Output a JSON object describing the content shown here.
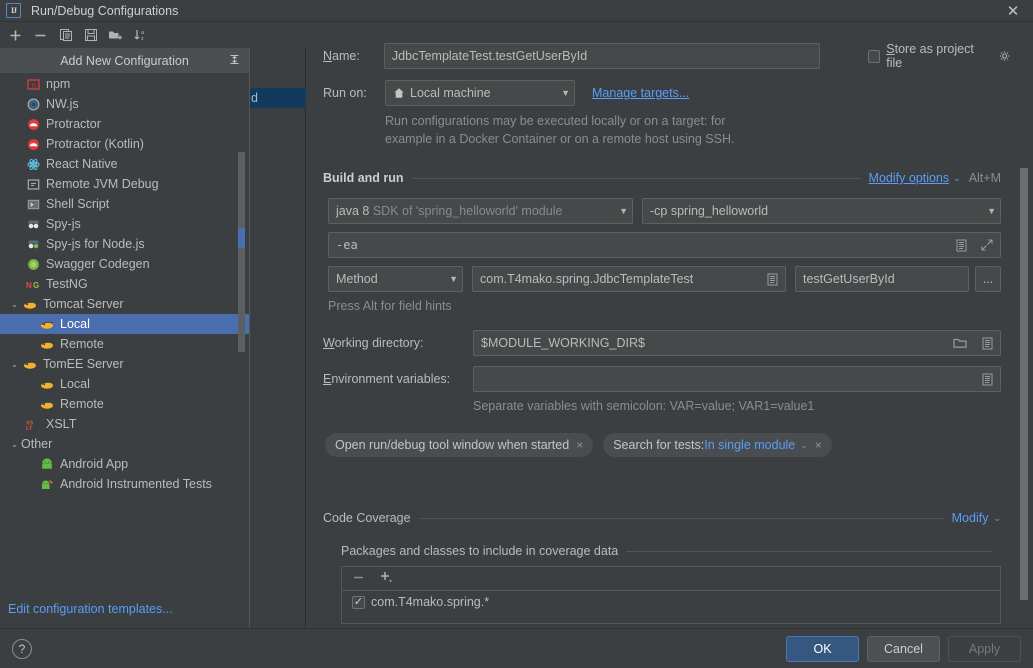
{
  "window": {
    "title": "Run/Debug Configurations",
    "logo_text": "IJ",
    "close_label": "✕"
  },
  "toolbar": {
    "items": [
      {
        "name": "add-configuration-button",
        "icon": "plus-icon",
        "label": "+"
      },
      {
        "name": "remove-configuration-button",
        "icon": "minus-icon",
        "label": "−"
      },
      {
        "name": "copy-configuration-button",
        "icon": "copy-icon",
        "label": "Copy"
      },
      {
        "name": "save-configuration-button",
        "icon": "save-icon",
        "label": "Save"
      },
      {
        "name": "new-folder-button",
        "icon": "new-folder-icon",
        "label": "New Folder"
      },
      {
        "name": "sort-configurations-button",
        "icon": "sort-az-icon",
        "label": "Sort"
      }
    ]
  },
  "sidebar": {
    "popup_title": "Add New Configuration",
    "popup_collapse_icon": "collapse-icon",
    "ghost_item_text": "d",
    "edit_templates_link": "Edit configuration templates...",
    "items": [
      {
        "label": "npm",
        "icon": "npm-icon",
        "indent": 2,
        "expander": "none",
        "selected": false
      },
      {
        "label": "NW.js",
        "icon": "nwjs-icon",
        "indent": 2,
        "expander": "none",
        "selected": false
      },
      {
        "label": "Protractor",
        "icon": "protractor-icon",
        "indent": 2,
        "expander": "none",
        "selected": false
      },
      {
        "label": "Protractor (Kotlin)",
        "icon": "protractor-icon",
        "indent": 2,
        "expander": "none",
        "selected": false
      },
      {
        "label": "React Native",
        "icon": "react-icon",
        "indent": 2,
        "expander": "none",
        "selected": false
      },
      {
        "label": "Remote JVM Debug",
        "icon": "remote-jvm-icon",
        "indent": 2,
        "expander": "none",
        "selected": false
      },
      {
        "label": "Shell Script",
        "icon": "shell-icon",
        "indent": 2,
        "expander": "none",
        "selected": false
      },
      {
        "label": "Spy-js",
        "icon": "spyjs-icon",
        "indent": 2,
        "expander": "none",
        "selected": false
      },
      {
        "label": "Spy-js for Node.js",
        "icon": "spyjs-node-icon",
        "indent": 2,
        "expander": "none",
        "selected": false
      },
      {
        "label": "Swagger Codegen",
        "icon": "swagger-icon",
        "indent": 2,
        "expander": "none",
        "selected": false
      },
      {
        "label": "TestNG",
        "icon": "testng-icon",
        "indent": 2,
        "expander": "none",
        "selected": false
      },
      {
        "label": "Tomcat Server",
        "icon": "tomcat-icon",
        "indent": 1,
        "expander": "expanded",
        "selected": false
      },
      {
        "label": "Local",
        "icon": "tomcat-icon",
        "indent": 3,
        "expander": "none",
        "selected": true
      },
      {
        "label": "Remote",
        "icon": "tomcat-icon",
        "indent": 3,
        "expander": "none",
        "selected": false
      },
      {
        "label": "TomEE Server",
        "icon": "tomcat-icon",
        "indent": 1,
        "expander": "expanded",
        "selected": false
      },
      {
        "label": "Local",
        "icon": "tomcat-icon",
        "indent": 3,
        "expander": "none",
        "selected": false
      },
      {
        "label": "Remote",
        "icon": "tomcat-icon",
        "indent": 3,
        "expander": "none",
        "selected": false
      },
      {
        "label": "XSLT",
        "icon": "xslt-icon",
        "indent": 2,
        "expander": "none",
        "selected": false
      },
      {
        "label": "Other",
        "icon": "none",
        "indent": 1,
        "expander": "expanded",
        "selected": false
      },
      {
        "label": "Android App",
        "icon": "android-icon",
        "indent": 3,
        "expander": "none",
        "selected": false
      },
      {
        "label": "Android Instrumented Tests",
        "icon": "android-test-icon",
        "indent": 3,
        "expander": "none",
        "selected": false
      }
    ]
  },
  "form": {
    "name_label": "Name:",
    "name_value": "JdbcTemplateTest.testGetUserById",
    "store_as_project_file_label": "Store as project file",
    "store_as_project_file_checked": false,
    "store_gear_icon": "gear-icon",
    "run_on_label": "Run on:",
    "run_on_value": "Local machine",
    "run_on_icon": "local-machine-icon",
    "manage_targets_link": "Manage targets...",
    "run_on_hint_line1": "Run configurations may be executed locally or on a target: for",
    "run_on_hint_line2": "example in a Docker Container or on a remote host using SSH."
  },
  "build_and_run": {
    "section_title": "Build and run",
    "modify_options_link": "Modify options",
    "modify_options_shortcut": "Alt+M",
    "jre_value_bold": "java 8",
    "jre_value_rest": " SDK of 'spring_helloworld' module",
    "classpath_value": "-cp spring_helloworld",
    "vm_options_value": "-ea",
    "vm_options_expand_icon": "expand-icon",
    "vm_options_macro_icon": "macro-icon",
    "kind_value": "Method",
    "class_value": "com.T4mako.spring.JdbcTemplateTest",
    "class_macro_icon": "macro-icon",
    "method_value": "testGetUserById",
    "method_browse_label": "...",
    "field_hints": "Press Alt for field hints",
    "working_directory_label": "Working directory:",
    "working_directory_value": "$MODULE_WORKING_DIR$",
    "working_dir_folder_icon": "folder-icon",
    "working_dir_macro_icon": "macro-icon",
    "environment_variables_label": "Environment variables:",
    "environment_variables_value": "",
    "environment_variables_placeholder": "",
    "env_macro_icon": "macro-icon",
    "env_hint": "Separate variables with semicolon: VAR=value; VAR1=value1",
    "chips": [
      {
        "label": "Open run/debug tool window when started",
        "value": "",
        "has_dropdown": false,
        "close": "×"
      },
      {
        "label": "Search for tests: ",
        "value": "In single module",
        "has_dropdown": true,
        "close": "×"
      }
    ]
  },
  "code_coverage": {
    "section_title": "Code Coverage",
    "modify_link": "Modify",
    "subsection_title": "Packages and classes to include in coverage data",
    "remove_icon": "minus-icon",
    "add_icon": "plus-dropdown-icon",
    "rows": [
      {
        "checked": true,
        "label": "com.T4mako.spring.*"
      }
    ]
  },
  "footer": {
    "help_label": "?",
    "ok_label": "OK",
    "cancel_label": "Cancel",
    "apply_label": "Apply"
  },
  "colors": {
    "background": "#3c3f41",
    "field_bg": "#45494a",
    "selection": "#4b6eaf",
    "link": "#589df6",
    "primary_button": "#365880"
  }
}
